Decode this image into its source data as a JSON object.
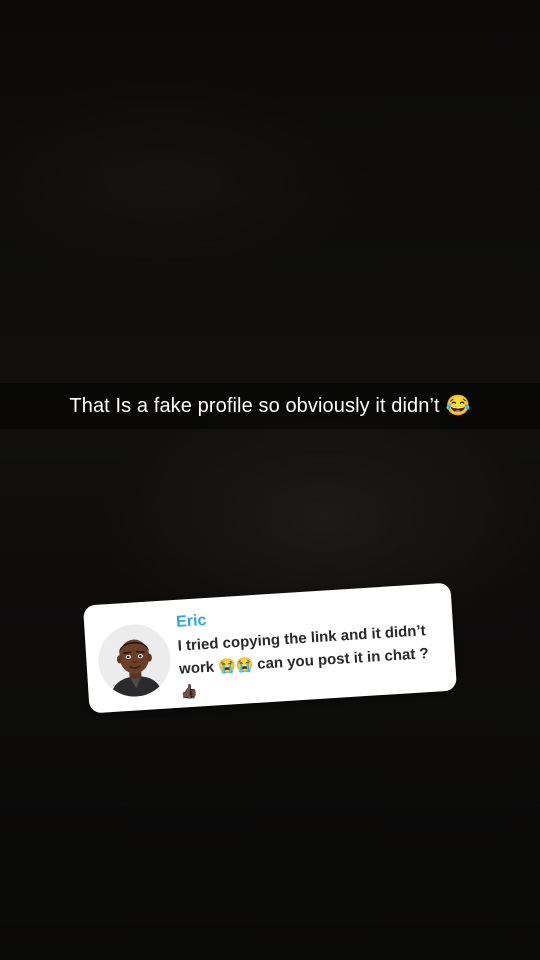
{
  "caption": {
    "text": "That Is a fake profile so obviously it didn’t",
    "emoji": "😂"
  },
  "reply": {
    "sender": "Eric",
    "message_part1": "I tried copying the link and it didn’t work",
    "message_emoji": "😭😭",
    "message_part2": "can you post it in chat ?",
    "message_end_emoji": "👍🏿",
    "sender_color": "#2ba7e0"
  }
}
